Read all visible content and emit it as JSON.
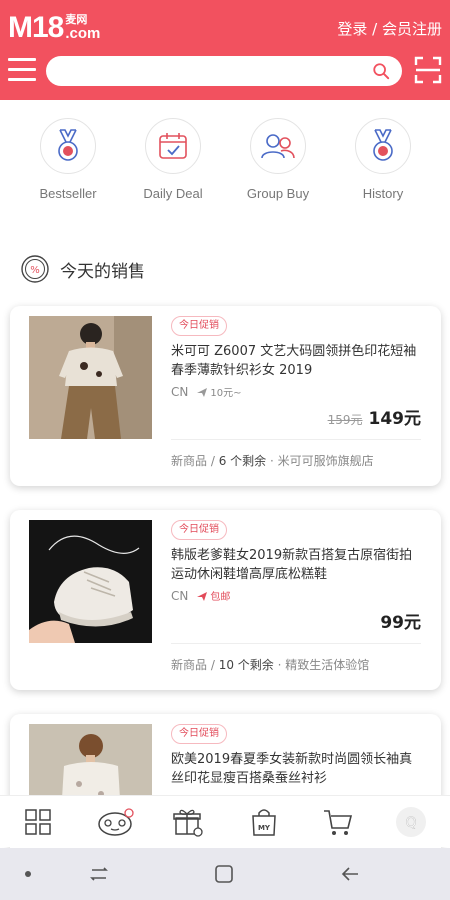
{
  "header": {
    "logo_main": "M18",
    "logo_cn": "麦网",
    "logo_com": ".com",
    "login_label": "登录 / 会员注册",
    "search_placeholder": "",
    "brand_color": "#f2515f"
  },
  "quicknav": [
    {
      "label": "Bestseller",
      "icon": "medal-icon"
    },
    {
      "label": "Daily Deal",
      "icon": "calendar-icon"
    },
    {
      "label": "Group Buy",
      "icon": "group-icon"
    },
    {
      "label": "History",
      "icon": "medal-icon"
    }
  ],
  "section": {
    "title": "今天的销售",
    "icon": "discount-icon"
  },
  "products": [
    {
      "tag": "今日促销",
      "title": "米可可 Z6007 文艺大码圆领拼色印花短袖春季薄款针织衫女 2019",
      "origin": "CN",
      "shipping": "10元~",
      "old_price": "159元",
      "price": "149元",
      "meta_prefix": "新商品 / ",
      "meta_count": "6 个剩余",
      "meta_shop": " · 米可可服饰旗舰店"
    },
    {
      "tag": "今日促销",
      "title": "韩版老爹鞋女2019新款百搭复古原宿街拍运动休闲鞋增高厚底松糕鞋",
      "origin": "CN",
      "shipping": "包邮",
      "old_price": "",
      "price": "99元",
      "meta_prefix": "新商品 / ",
      "meta_count": "10 个剩余",
      "meta_shop": " · 精致生活体验馆"
    },
    {
      "tag": "今日促销",
      "title": "欧美2019春夏季女装新款时尚圆领长袖真丝印花显瘦百搭桑蚕丝衬衫"
    }
  ],
  "bottomnav": [
    {
      "icon": "grid-icon"
    },
    {
      "icon": "mascot-icon"
    },
    {
      "icon": "gift-icon"
    },
    {
      "icon": "my-bag-icon",
      "text": "MY"
    },
    {
      "icon": "cart-icon"
    },
    {
      "icon": "q-icon",
      "text": "Q"
    }
  ]
}
